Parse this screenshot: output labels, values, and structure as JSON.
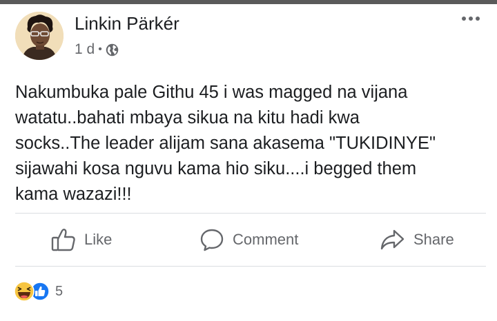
{
  "post": {
    "author": "Linkin Pärkér",
    "time": "1 d",
    "meta_separator": "•",
    "privacy_icon": "globe-icon",
    "text": "Nakumbuka pale Githu 45 i was magged na vijana\nwatatu..bahati mbaya sikua na kitu hadi kwa\nsocks..The leader alijam sana akasema \"TUKIDINYE\"\nsijawahi kosa nguvu kama hio siku....i begged them\nkama wazazi!!!"
  },
  "actions": {
    "like_label": "Like",
    "comment_label": "Comment",
    "share_label": "Share"
  },
  "reactions": {
    "types": [
      "haha",
      "like"
    ],
    "count": "5"
  },
  "colors": {
    "text": "#1c1e21",
    "secondary": "#65676b",
    "divider": "#dadde1",
    "like_blue": "#1877f2",
    "haha_yellow": "#f7c542"
  }
}
